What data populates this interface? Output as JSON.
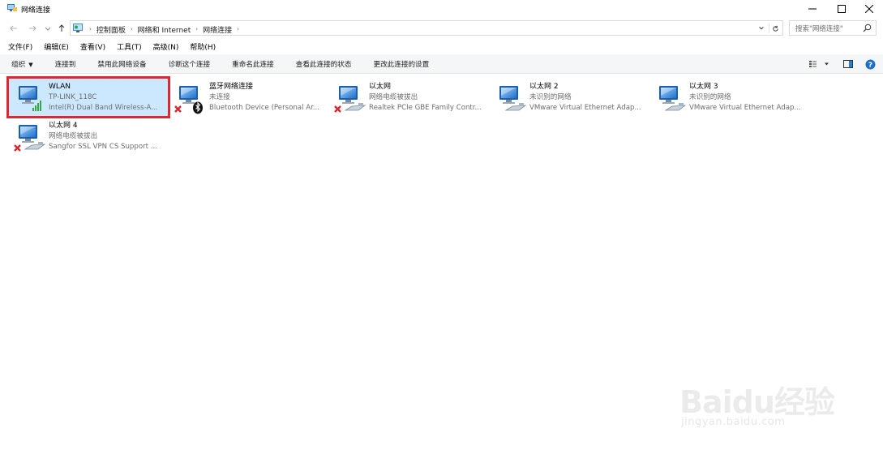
{
  "window": {
    "title": "网络连接"
  },
  "address": {
    "crumbs": [
      "控制面板",
      "网络和 Internet",
      "网络连接"
    ],
    "search_placeholder": "搜索\"网络连接\""
  },
  "menu": [
    "文件(F)",
    "编辑(E)",
    "查看(V)",
    "工具(T)",
    "高级(N)",
    "帮助(H)"
  ],
  "commands": {
    "organize": "组织",
    "items": [
      "连接到",
      "禁用此网络设备",
      "诊断这个连接",
      "重命名此连接",
      "查看此连接的状态",
      "更改此连接的设置"
    ]
  },
  "connections": [
    {
      "name": "WLAN",
      "status": "TP-LINK_118C",
      "device": "Intel(R) Dual Band Wireless-A...",
      "icon": "wifi-adapter-icon",
      "selected": true
    },
    {
      "name": "蓝牙网络连接",
      "status": "未连接",
      "device": "Bluetooth Device (Personal Ar...",
      "icon": "bluetooth-adapter-icon"
    },
    {
      "name": "以太网",
      "status": "网络电缆被拔出",
      "device": "Realtek PCIe GBE Family Contr...",
      "icon": "ethernet-disconnected-icon"
    },
    {
      "name": "以太网 2",
      "status": "未识别的网络",
      "device": "VMware Virtual Ethernet Adap...",
      "icon": "ethernet-adapter-icon"
    },
    {
      "name": "以太网 3",
      "status": "未识别的网络",
      "device": "VMware Virtual Ethernet Adap...",
      "icon": "ethernet-adapter-icon"
    },
    {
      "name": "以太网 4",
      "status": "网络电缆被拔出",
      "device": "Sangfor SSL VPN CS Support ...",
      "icon": "ethernet-disconnected-icon"
    }
  ],
  "watermark": {
    "logo": "Baidu经验",
    "url": "jingyan.baidu.com"
  },
  "colors": {
    "selection": "#cce8ff",
    "highlight_border": "#e0262f",
    "monitor_blue": "#2b7cd3",
    "error_red": "#d9262c"
  }
}
